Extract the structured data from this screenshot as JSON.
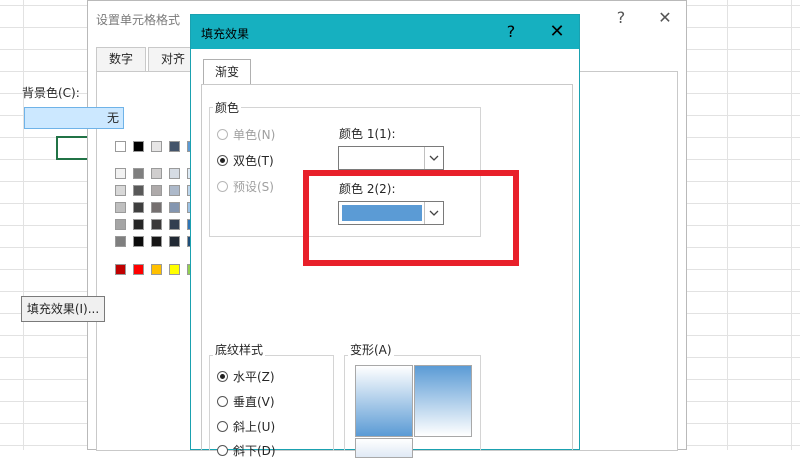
{
  "back_dialog": {
    "title": "设置单元格格式",
    "help": "?",
    "close": "✕",
    "tabs": [
      "数字",
      "对齐"
    ],
    "background_label": "背景色(C):",
    "none_button": "无",
    "fill_effects_button": "填充效果(I)..."
  },
  "dialog": {
    "title": "填充效果",
    "help": "?",
    "close": "✕",
    "tab": "渐变",
    "colors_group": {
      "label": "颜色",
      "options": [
        {
          "label": "单色(N)",
          "state": "disabled"
        },
        {
          "label": "双色(T)",
          "state": "checked"
        },
        {
          "label": "预设(S)",
          "state": "disabled"
        }
      ],
      "color1_label": "颜色 1(1):",
      "color2_label": "颜色 2(2):",
      "color2_value": "#5b9bd5"
    },
    "shading_group": {
      "label": "底纹样式",
      "options": [
        {
          "label": "水平(Z)",
          "state": "checked"
        },
        {
          "label": "垂直(V)",
          "state": "normal"
        },
        {
          "label": "斜上(U)",
          "state": "normal"
        },
        {
          "label": "斜下(D)",
          "state": "normal"
        }
      ]
    },
    "variants_label": "变形(A)"
  },
  "colors": {
    "accent_titlebar": "#16b0c0",
    "highlight": "#e8202a",
    "gradient_blue": "#5b9bd5"
  }
}
